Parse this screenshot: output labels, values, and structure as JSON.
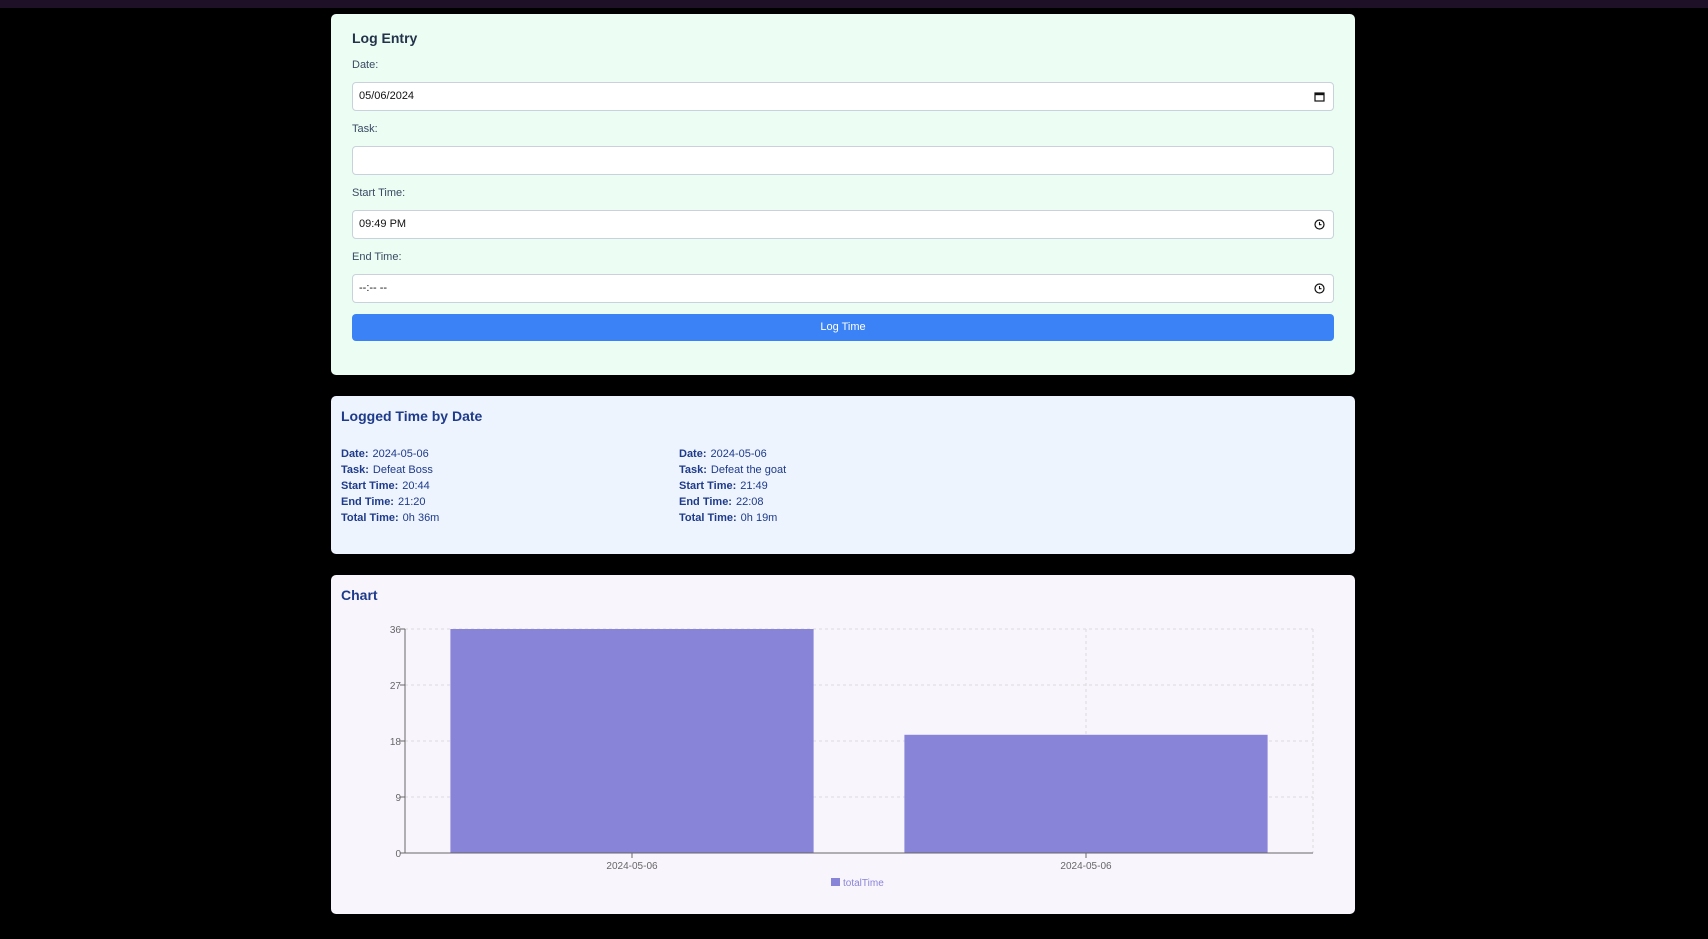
{
  "log_entry": {
    "title": "Log Entry",
    "date_label": "Date:",
    "date_value": "05/06/2024",
    "task_label": "Task:",
    "task_value": "",
    "start_label": "Start Time:",
    "start_value": "09:49 PM",
    "end_label": "End Time:",
    "end_value": "--:-- --",
    "submit_label": "Log Time",
    "button_color": "#3b82f6"
  },
  "logged": {
    "title": "Logged Time by Date",
    "keys": {
      "date": "Date:",
      "task": "Task:",
      "start": "Start Time:",
      "end": "End Time:",
      "total": "Total Time:"
    },
    "entries": [
      {
        "date": "2024-05-06",
        "task": "Defeat Boss",
        "start": "20:44",
        "end": "21:20",
        "total": "0h 36m"
      },
      {
        "date": "2024-05-06",
        "task": "Defeat the goat",
        "start": "21:49",
        "end": "22:08",
        "total": "0h 19m"
      }
    ]
  },
  "chart_section": {
    "title": "Chart"
  },
  "chart_data": {
    "type": "bar",
    "categories": [
      "2024-05-06",
      "2024-05-06"
    ],
    "series": [
      {
        "name": "totalTime",
        "values": [
          36,
          19
        ],
        "color": "#8884d8"
      }
    ],
    "ylim": [
      0,
      36
    ],
    "yticks": [
      "0",
      "9",
      "18",
      "27",
      "36"
    ],
    "grid": true,
    "legend": "bottom-center"
  }
}
